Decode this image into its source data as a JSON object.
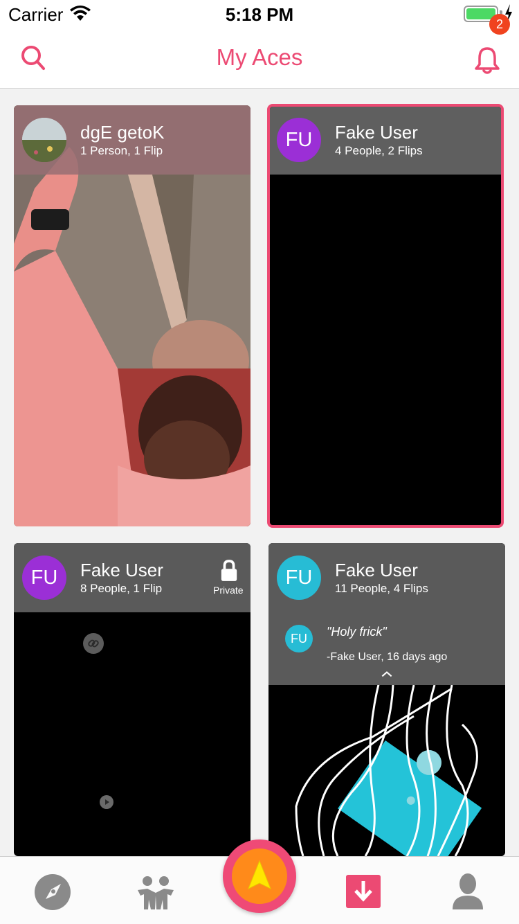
{
  "status": {
    "carrier": "Carrier",
    "time": "5:18 PM"
  },
  "nav": {
    "title": "My Aces",
    "notification_count": "2"
  },
  "cards": [
    {
      "name": "dgE getoK",
      "meta": "1 Person, 1 Flip",
      "avatar": ""
    },
    {
      "name": "Fake User",
      "meta": "4 People, 2 Flips",
      "avatar": "FU"
    },
    {
      "name": "Fake User",
      "meta": "8 People, 1 Flip",
      "avatar": "FU",
      "badge": "Private"
    },
    {
      "name": "Fake User",
      "meta": "11 People, 4 Flips",
      "avatar": "FU",
      "quote": "\"Holy frick\"",
      "quote_author": "-Fake User, 16 days ago",
      "quote_avatar": "FU"
    }
  ],
  "colors": {
    "accent": "#ec4a73",
    "avatar_purple": "#9b2fd6",
    "avatar_teal": "#27bcd5"
  }
}
